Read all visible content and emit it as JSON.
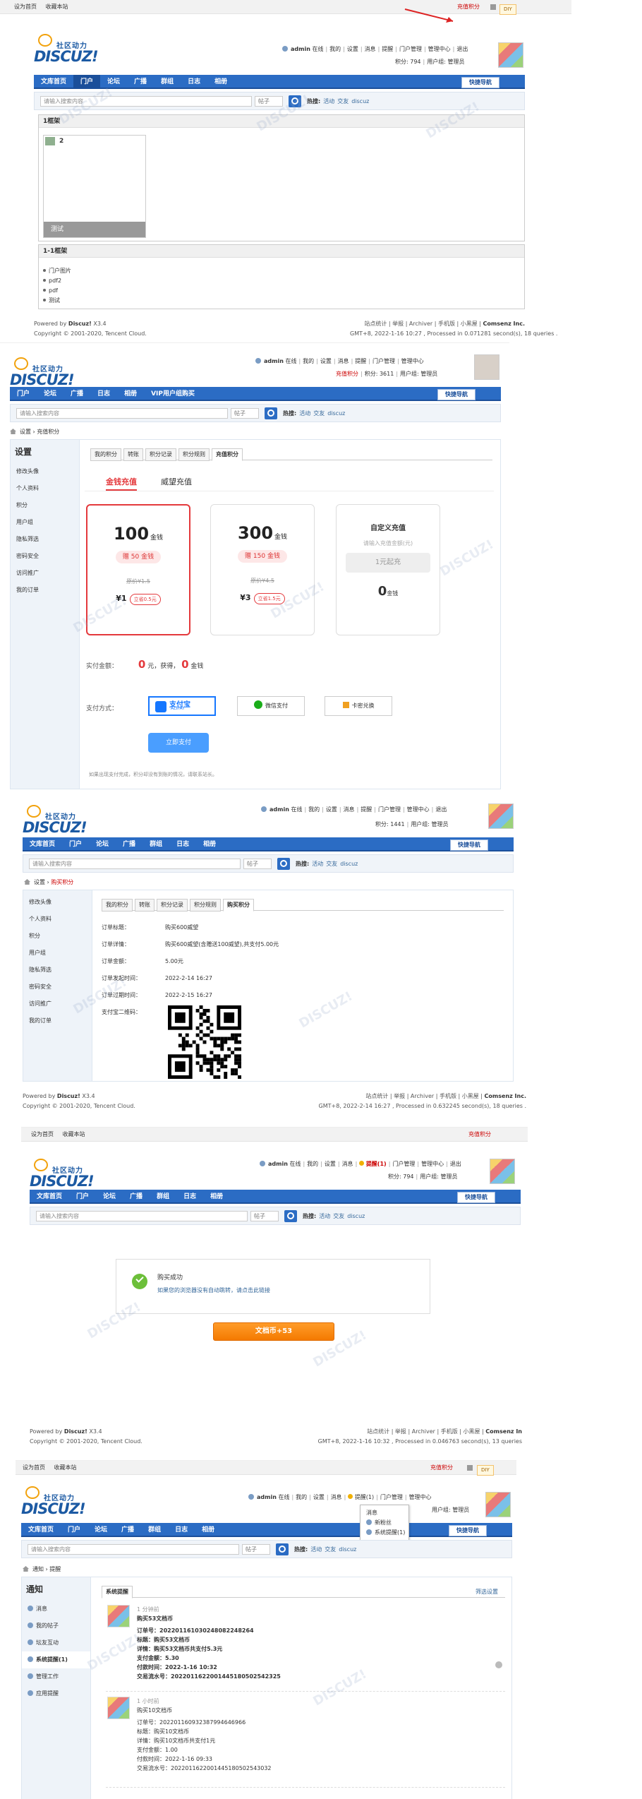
{
  "topbar": {
    "set_home": "设为首页",
    "bookmark": "收藏本站",
    "recharge": "充值积分",
    "diy": "DIY"
  },
  "logo": {
    "sub": "社区动力",
    "main": "DISCUZ!"
  },
  "user": {
    "name": "admin",
    "status": "在线",
    "my": "我的",
    "settings": "设置",
    "messages": "消息",
    "remind": "提醒",
    "remind_count": "提醒(1)",
    "portal_admin": "门户管理",
    "admin_center": "管理中心",
    "logout": "退出",
    "points_794": "积分: 794",
    "points_3611": "积分: 3611",
    "points_1441": "积分: 1441",
    "group": "用户组: 管理员"
  },
  "nav1": [
    "文库首页",
    "门户",
    "论坛",
    "广播",
    "群组",
    "日志",
    "相册"
  ],
  "nav2": [
    "门户",
    "论坛",
    "广播",
    "日志",
    "相册",
    "VIP用户组购买"
  ],
  "nav_quick": "快捷导航",
  "search": {
    "placeholder": "请输入搜索内容",
    "type": "帖子",
    "hot_label": "热搜:",
    "hot": [
      "活动",
      "交友",
      "discuz"
    ]
  },
  "p1": {
    "frame1_title": "1框架",
    "item_label": "2",
    "thumb_caption": "测试",
    "frame2_title": "1-1框架",
    "list": [
      "门户图片",
      "pdf2",
      "pdf",
      "测试"
    ]
  },
  "footer": {
    "powered": "Powered by",
    "brand": "Discuz!",
    "version": "X3.4",
    "copyright": "Copyright © 2001-2020, Tencent Cloud.",
    "links": "站点统计 | 举报 | Archiver | 手机版 | 小黑屋 |",
    "company": "Comsenz Inc.",
    "company_short": "Comsenz In",
    "time1": "GMT+8, 2022-1-16 10:27 , Processed in 0.071281 second(s), 18 queries .",
    "time2": "GMT+8, 2022-2-14 16:27 , Processed in 0.632245 second(s), 18 queries .",
    "time3": "GMT+8, 2022-1-16 10:32 , Processed in 0.046763 second(s), 13 queries"
  },
  "p2": {
    "crumb": [
      "设置",
      "充值积分"
    ],
    "side_title": "设置",
    "side": [
      "修改头像",
      "个人资料",
      "积分",
      "用户组",
      "隐私筛选",
      "密码安全",
      "访问推广",
      "我的订单"
    ],
    "tabs": [
      "我的积分",
      "转账",
      "积分记录",
      "积分规则",
      "充值积分"
    ],
    "subtabs": [
      "金钱充值",
      "威望充值"
    ],
    "pkgs": [
      {
        "num": "100",
        "unit": "金钱",
        "gift": "赠 50 金钱",
        "orig": "原价¥1.5",
        "price": "¥1",
        "save": "立省0.5元"
      },
      {
        "num": "300",
        "unit": "金钱",
        "gift": "赠 150 金钱",
        "orig": "原价¥4.5",
        "price": "¥3",
        "save": "立省1.5元"
      }
    ],
    "custom": {
      "title": "自定义充值",
      "placeholder": "请输入充值金额(元)",
      "min": "1元起充",
      "zero": "0",
      "unit": "金钱"
    },
    "pay_amount_label": "实付金额：",
    "pay_amount": "0",
    "pay_yuan": "元，获得，",
    "pay_get": "0",
    "pay_unit": "金钱",
    "pay_method_label": "支付方式：",
    "methods": [
      "支付宝",
      "微信支付",
      "卡密兑换"
    ],
    "alipay_sub": "ALIPAY",
    "submit": "立即支付",
    "tip": "如果出现支付完成，积分却没有到账的情况，请联系站长。"
  },
  "p3": {
    "crumb": [
      "设置",
      "购买积分"
    ],
    "tabs": [
      "我的积分",
      "转账",
      "积分记录",
      "积分规则",
      "购买积分"
    ],
    "rows": [
      {
        "k": "订单标题：",
        "v": "购买600威望"
      },
      {
        "k": "订单详情：",
        "v": "购买600威望(含赠送100威望),共支付5.00元"
      },
      {
        "k": "订单金额：",
        "v": "5.00元"
      },
      {
        "k": "订单发起时间：",
        "v": "2022-2-14 16:27"
      },
      {
        "k": "订单过期时间：",
        "v": "2022-2-15 16:27"
      },
      {
        "k": "支付宝二维码：",
        "v": ""
      }
    ]
  },
  "p4": {
    "title": "购买成功",
    "link": "如果您的浏览器没有自动跳转，请点击此链接",
    "btn": "文档币+53"
  },
  "p5": {
    "crumb": [
      "通知",
      "提醒"
    ],
    "side_title": "通知",
    "side": [
      "消息",
      "我的帖子",
      "坛友互动",
      "系统提醒(1)",
      "管理工作",
      "应用提醒"
    ],
    "dropdown": [
      "消息",
      "新粉丝",
      "系统提醒(1)"
    ],
    "tab": "系统提醒",
    "filter": "筛选设置",
    "msgs": [
      {
        "time": "1 分钟前",
        "title": "购买53文档币",
        "lines": [
          "订单号：20220116103024808224826​4",
          "标题：购买53文档币",
          "详情：购买53文档币共支付5.3元",
          "支付金额：5.30",
          "付款时间：2022-1-16 10:32",
          "交易流水号：2022011622001445180502542325"
        ]
      },
      {
        "time": "1 小时前",
        "title": "购买10文档币",
        "lines": [
          "订单号：202201160932387994646966",
          "标题：购买10文档币",
          "详情：购买10文档币共支付1元",
          "支付金额：1.00",
          "付款时间：2022-1-16 09:33",
          "交易流水号：2022011622001445180502543032"
        ]
      }
    ]
  }
}
